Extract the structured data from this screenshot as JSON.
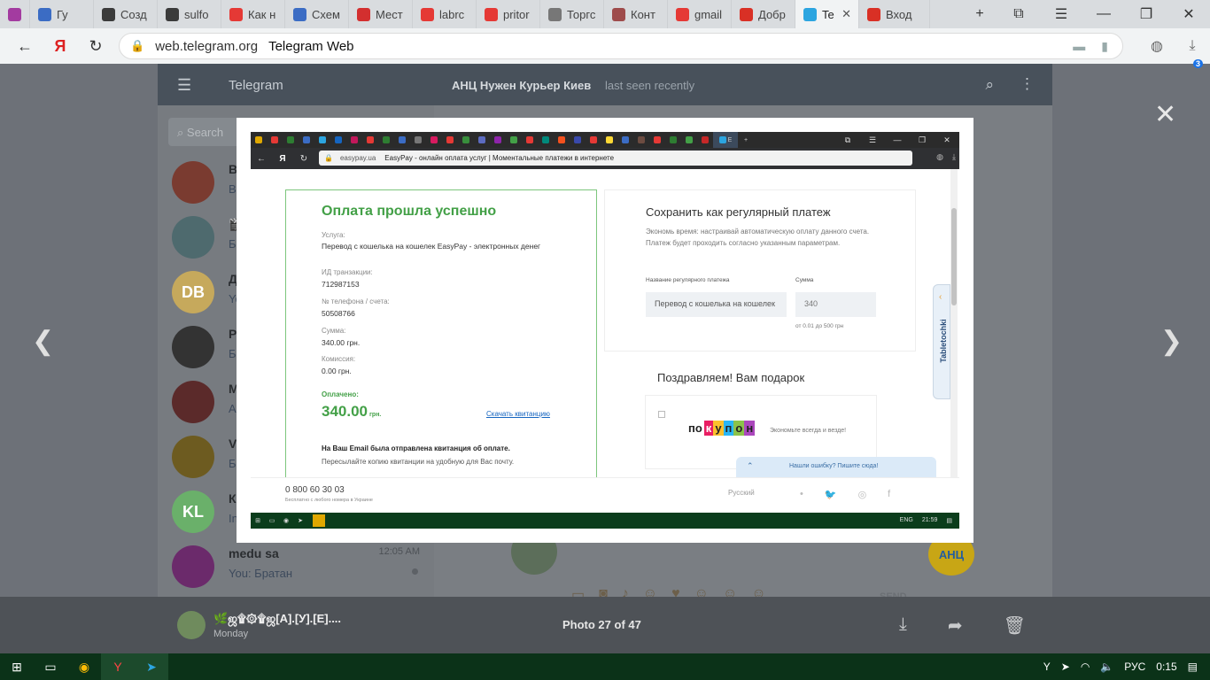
{
  "browser": {
    "tabs": [
      {
        "label": "",
        "icon_color": "#a33ba0"
      },
      {
        "label": "Гу",
        "icon_color": "#3b6cc4"
      },
      {
        "label": "Созд",
        "icon_color": "#3b3b3b"
      },
      {
        "label": "sulfo",
        "icon_color": "#3b3b3b"
      },
      {
        "label": "Как н",
        "icon_color": "#e53935"
      },
      {
        "label": "Схем",
        "icon_color": "#3b6cc4"
      },
      {
        "label": "Мест",
        "icon_color": "#d32f2f"
      },
      {
        "label": "labrc",
        "icon_color": "#e53935"
      },
      {
        "label": "pritor",
        "icon_color": "#e53935"
      },
      {
        "label": "Торгс",
        "icon_color": "#777777"
      },
      {
        "label": "Конт",
        "icon_color": "#9e4b4b"
      },
      {
        "label": "gmail",
        "icon_color": "#e53935"
      },
      {
        "label": "Добр",
        "icon_color": "#d93025"
      },
      {
        "label": "Te",
        "icon_color": "#2ca5e0",
        "active": true
      },
      {
        "label": "Вход",
        "icon_color": "#d93025"
      }
    ],
    "url": "web.telegram.org",
    "page_title": "Telegram Web",
    "downloads_badge": "3"
  },
  "telegram": {
    "app_name": "Telegram",
    "chat_title": "АНЦ Нужен Курьер Киев",
    "chat_status": "last seen recently",
    "search_placeholder": "Search",
    "chats": [
      {
        "initials": "",
        "name": "В",
        "msg": "В",
        "color": "#7a3b30"
      },
      {
        "initials": "",
        "name": "🎬",
        "msg": "Б",
        "color": "#4e6a6e"
      },
      {
        "initials": "DB",
        "name": "Д",
        "msg": "Yo",
        "color": "#c6a95c"
      },
      {
        "initials": "",
        "name": "P",
        "msg": "Б",
        "color": "#333333"
      },
      {
        "initials": "",
        "name": "М",
        "msg": "А",
        "color": "#5b2a2a"
      },
      {
        "initials": "",
        "name": "V",
        "msg": "Б",
        "color": "#6d5b20"
      },
      {
        "initials": "KL",
        "name": "К",
        "msg": "In",
        "color": "#6ab06a"
      },
      {
        "initials": "",
        "name": "medu sa",
        "msg": "You: Братан",
        "time": "12:05 AM",
        "color": "#6b2a6b"
      }
    ],
    "send_label": "SEND",
    "anc_label": "АНЦ"
  },
  "viewer": {
    "sender_name": "🌿ஜ۩۞۩ஜ[А].[У].[Е]....",
    "sender_day": "Monday",
    "counter": "Photo 27 of 47"
  },
  "photo": {
    "tab_labels": [
      "Я",
      "Я",
      "В",
      "Д",
      "Я",
      "Е"
    ],
    "url": "easypay.ua",
    "page_title": "EasyPay - онлайн оплата услуг | Моментальные платежи в интернете",
    "success": {
      "title": "Оплата прошла успешно",
      "service_label": "Услуга:",
      "service_value": "Перевод с кошелька на кошелек EasyPay - электронных денег",
      "txn_label": "ИД транзакции:",
      "txn_value": "712987153",
      "phone_label": "№ телефона / счета:",
      "phone_value": "50508766",
      "sum_label": "Сумма:",
      "sum_value": "340.00 грн.",
      "fee_label": "Комиссия:",
      "fee_value": "0.00 грн.",
      "paid_label": "Оплачено:",
      "paid_amount": "340.00",
      "paid_currency": "грн.",
      "receipt_link": "Скачать квитанцию",
      "email_note": "На Ваш Email была отправлена квитанция об оплате.",
      "forward_note": "Пересылайте копию квитанции на удобную для Вас почту."
    },
    "regular": {
      "title": "Сохранить как регулярный платеж",
      "desc": "Экономь время: настраивай автоматическую оплату данного счета. Платеж будет проходить согласно указанным параметрам.",
      "name_label": "Название регулярного платежа",
      "sum_label": "Сумма",
      "name_value": "Перевод с кошелька на кошелек",
      "sum_value": "340",
      "hint": "от 0.01 до 500 грн"
    },
    "gift": {
      "title": "Поздравляем! Вам подарок",
      "logo_letters": [
        "по",
        "к",
        "у",
        "п",
        "о",
        "н"
      ],
      "slogan": "Экономьте всегда и везде!"
    },
    "side_tab": "Tabletochki",
    "bug_bar": "Нашли ошибку? Пишите сюда!",
    "footer": {
      "phone": "0 800 60 30 03",
      "free": "Бесплатно с любого номера в Украине",
      "lang": "Русский"
    },
    "taskbar": {
      "lang": "ENG",
      "time": "21:59"
    }
  },
  "taskbar": {
    "lang": "РУС",
    "time": "0:15"
  }
}
